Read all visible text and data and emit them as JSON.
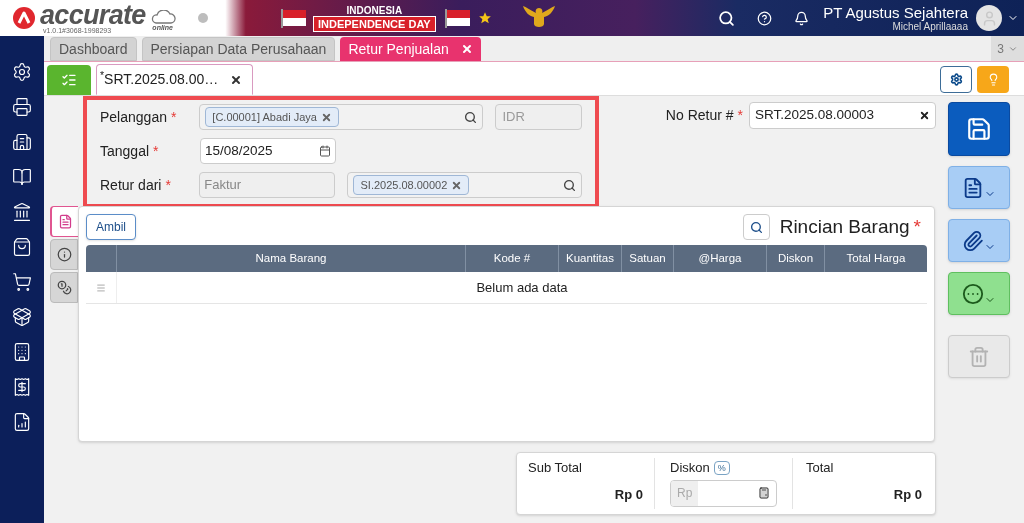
{
  "header": {
    "logo": "accurate",
    "logo_sub": "online",
    "version": "v1.0.1#3068-1998293",
    "banner_line1": "INDONESIA",
    "banner_line2": "INDEPENDENCE DAY",
    "company": "PT Agustus Sejahtera",
    "user": "Michel Aprillaaaa"
  },
  "module_tabs": [
    {
      "label": "Dashboard",
      "selected": false,
      "closable": false
    },
    {
      "label": "Persiapan Data Perusahaan",
      "selected": false,
      "closable": false
    },
    {
      "label": "Retur Penjualan",
      "selected": true,
      "closable": true
    }
  ],
  "tab_count": "3",
  "doc_tabs": [
    {
      "label": "SRT.2025.08.00…",
      "modified_mark": "*",
      "selected": true
    }
  ],
  "form": {
    "customer": {
      "label": "Pelanggan",
      "mark": "*",
      "chip": "[C.00001] Abadi Jaya",
      "currency": "IDR"
    },
    "date": {
      "label": "Tanggal",
      "mark": "*",
      "value": "15/08/2025"
    },
    "return_from": {
      "label": "Retur dari",
      "mark": "*",
      "source": "Faktur",
      "chip": "SI.2025.08.00002"
    },
    "number": {
      "label": "No Retur #",
      "mark": "*",
      "value": "SRT.2025.08.00003"
    }
  },
  "side_tabs": [
    {
      "kind": "document",
      "selected": true
    },
    {
      "kind": "info",
      "selected": false
    },
    {
      "kind": "cost",
      "selected": false
    }
  ],
  "details": {
    "button": "Ambil",
    "title": "Rincian Barang",
    "mark": "*",
    "columns": [
      "Nama Barang",
      "Kode #",
      "Kuantitas",
      "Satuan",
      "@Harga",
      "Diskon",
      "Total Harga"
    ],
    "empty": "Belum ada data"
  },
  "summary": {
    "sub_total_label": "Sub Total",
    "sub_total": "Rp 0",
    "discount_label": "Diskon",
    "discount_badge": "%",
    "discount_prefix": "Rp",
    "total_label": "Total",
    "total": "Rp 0"
  },
  "actions": [
    {
      "kind": "save",
      "disabled": false
    },
    {
      "kind": "document",
      "disabled": false
    },
    {
      "kind": "attach",
      "disabled": false
    },
    {
      "kind": "more",
      "disabled": false
    },
    {
      "kind": "delete",
      "disabled": true
    }
  ]
}
